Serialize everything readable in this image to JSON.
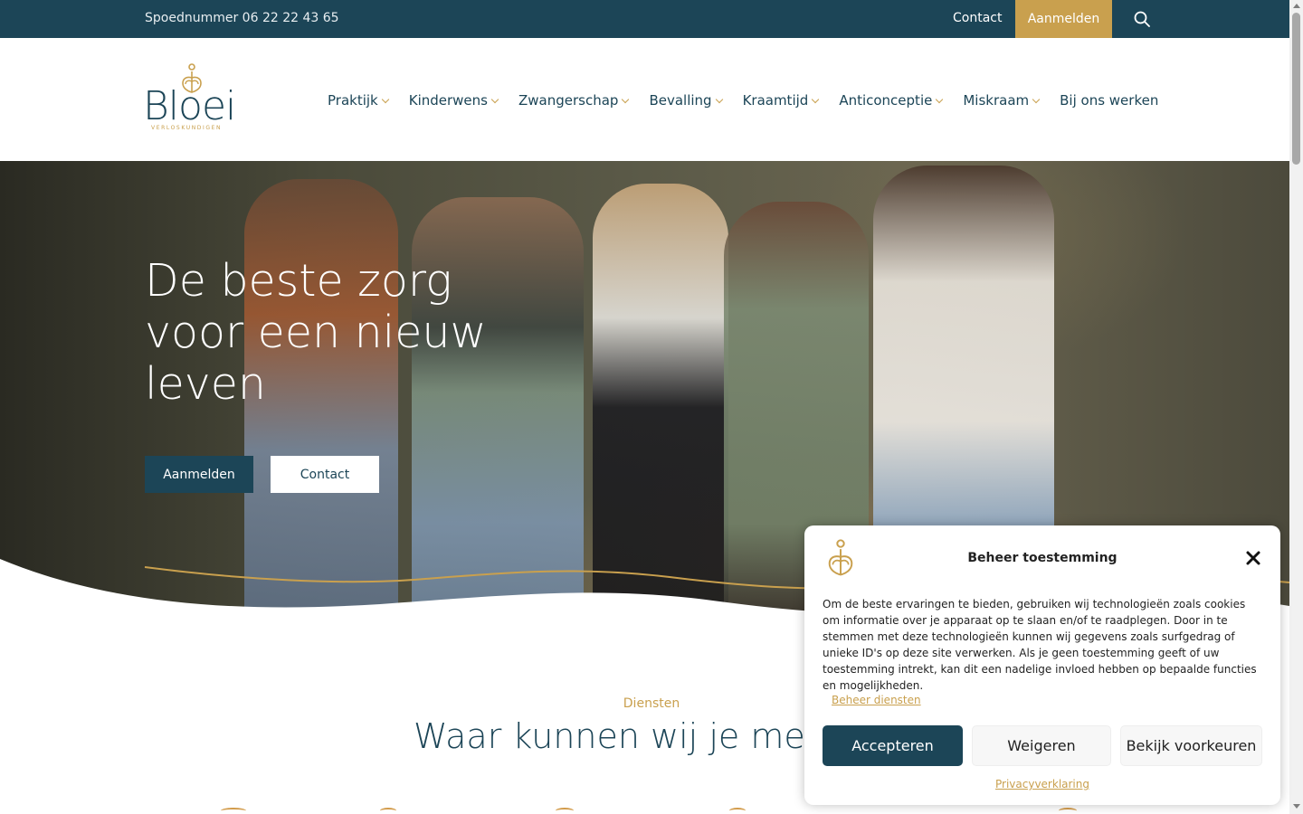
{
  "topbar": {
    "phone": "Spoednummer 06 22 22 43 65",
    "contact": "Contact",
    "aanmelden": "Aanmelden",
    "search_icon": "search-icon"
  },
  "logo": {
    "word": "Bloei",
    "sub": "VERLOSKUNDIGEN"
  },
  "nav": {
    "items": [
      {
        "label": "Praktijk",
        "dropdown": true
      },
      {
        "label": "Kinderwens",
        "dropdown": true
      },
      {
        "label": "Zwangerschap",
        "dropdown": true
      },
      {
        "label": "Bevalling",
        "dropdown": true
      },
      {
        "label": "Kraamtijd",
        "dropdown": true
      },
      {
        "label": "Anticonceptie",
        "dropdown": true
      },
      {
        "label": "Miskraam",
        "dropdown": true
      },
      {
        "label": "Bij ons werken",
        "dropdown": false
      }
    ]
  },
  "hero": {
    "title": "De beste zorg voor een nieuw leven",
    "btn_primary": "Aanmelden",
    "btn_secondary": "Contact"
  },
  "services": {
    "kicker": "Diensten",
    "title": "Waar kunnen wij je mee h"
  },
  "consent": {
    "title": "Beheer toestemming",
    "text": "Om de beste ervaringen te bieden, gebruiken wij technologieën zoals cookies om informatie over je apparaat op te slaan en/of te raadplegen. Door in te stemmen met deze technologieën kunnen wij gegevens zoals surfgedrag of unieke ID's op deze site verwerken. Als je geen toestemming geeft of uw toestemming intrekt, kan dit een nadelige invloed hebben op bepaalde functies en mogelijkheden.",
    "manage": "Beheer diensten",
    "accept": "Accepteren",
    "reject": "Weigeren",
    "prefs": "Bekijk voorkeuren",
    "privacy": "Privacyverklaring"
  },
  "colors": {
    "primary": "#1c4557",
    "accent": "#c9a04e"
  }
}
